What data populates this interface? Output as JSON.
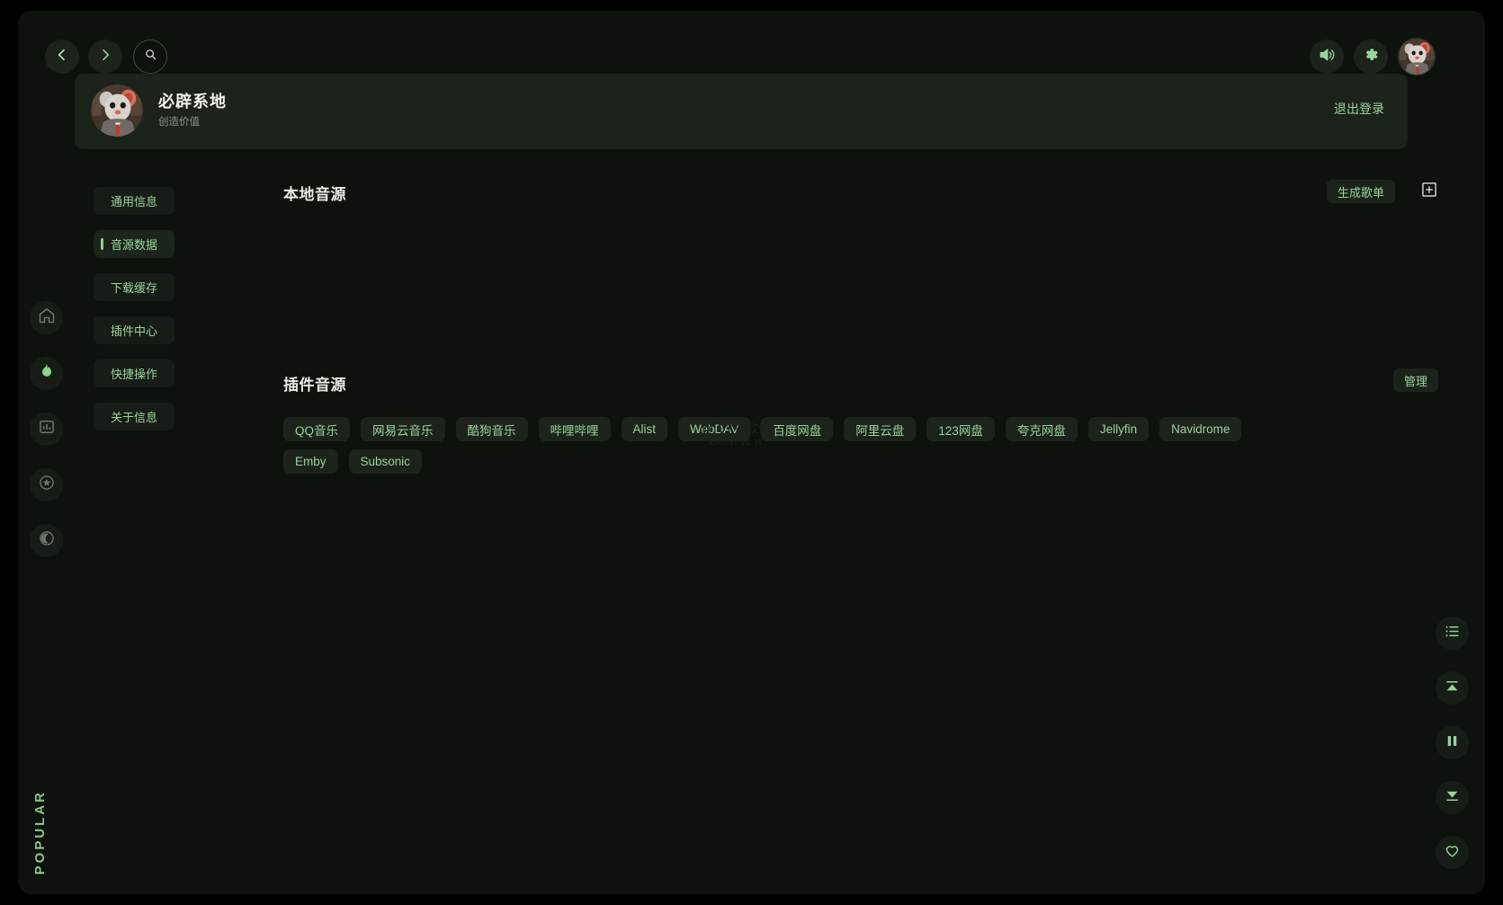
{
  "topbar": {
    "back_icon": "chevron-left-icon",
    "forward_icon": "chevron-right-icon",
    "search_icon": "search-icon",
    "volume_icon": "volume-icon",
    "settings_icon": "gear-icon",
    "avatar_icon": "user-avatar"
  },
  "profile": {
    "name": "必辟系地",
    "subtitle": "创造价值",
    "logout_label": "退出登录"
  },
  "rail": {
    "items": [
      {
        "name": "home",
        "icon": "home-icon",
        "active": false
      },
      {
        "name": "hot",
        "icon": "flame-icon",
        "active": true
      },
      {
        "name": "rank",
        "icon": "bar-chart-icon",
        "active": false
      },
      {
        "name": "favorite",
        "icon": "star-icon",
        "active": false
      },
      {
        "name": "theme",
        "icon": "moon-icon",
        "active": false
      }
    ],
    "popular_label": "POPULAR"
  },
  "subnav": {
    "items": [
      {
        "label": "通用信息",
        "active": false
      },
      {
        "label": "音源数据",
        "active": true
      },
      {
        "label": "下载缓存",
        "active": false
      },
      {
        "label": "插件中心",
        "active": false
      },
      {
        "label": "快捷操作",
        "active": false
      },
      {
        "label": "关于信息",
        "active": false
      }
    ]
  },
  "local_source": {
    "title": "本地音源",
    "generate_label": "生成歌单",
    "add_icon": "plus-square-icon"
  },
  "plugin_source": {
    "title": "插件音源",
    "manage_label": "管理",
    "tags": [
      "QQ音乐",
      "网易云音乐",
      "酷狗音乐",
      "哔哩哔哩",
      "Alist",
      "WebDAV",
      "百度网盘",
      "阿里云盘",
      "123网盘",
      "夸克网盘",
      "Jellyfin",
      "Navidrome",
      "Emby",
      "Subsonic"
    ]
  },
  "watermark": {
    "line1": "@ 1个好软件",
    "line2": "XIAOYI.VE IT"
  },
  "player": {
    "buttons": [
      {
        "name": "playlist",
        "icon": "list-icon"
      },
      {
        "name": "previous",
        "icon": "previous-icon"
      },
      {
        "name": "pause",
        "icon": "pause-icon"
      },
      {
        "name": "next",
        "icon": "next-icon"
      },
      {
        "name": "favorite",
        "icon": "heart-icon"
      }
    ]
  },
  "colors": {
    "background": "#0d120d",
    "panel": "#1b231b",
    "accent": "#9bd39b",
    "text": "#e9eae4"
  }
}
